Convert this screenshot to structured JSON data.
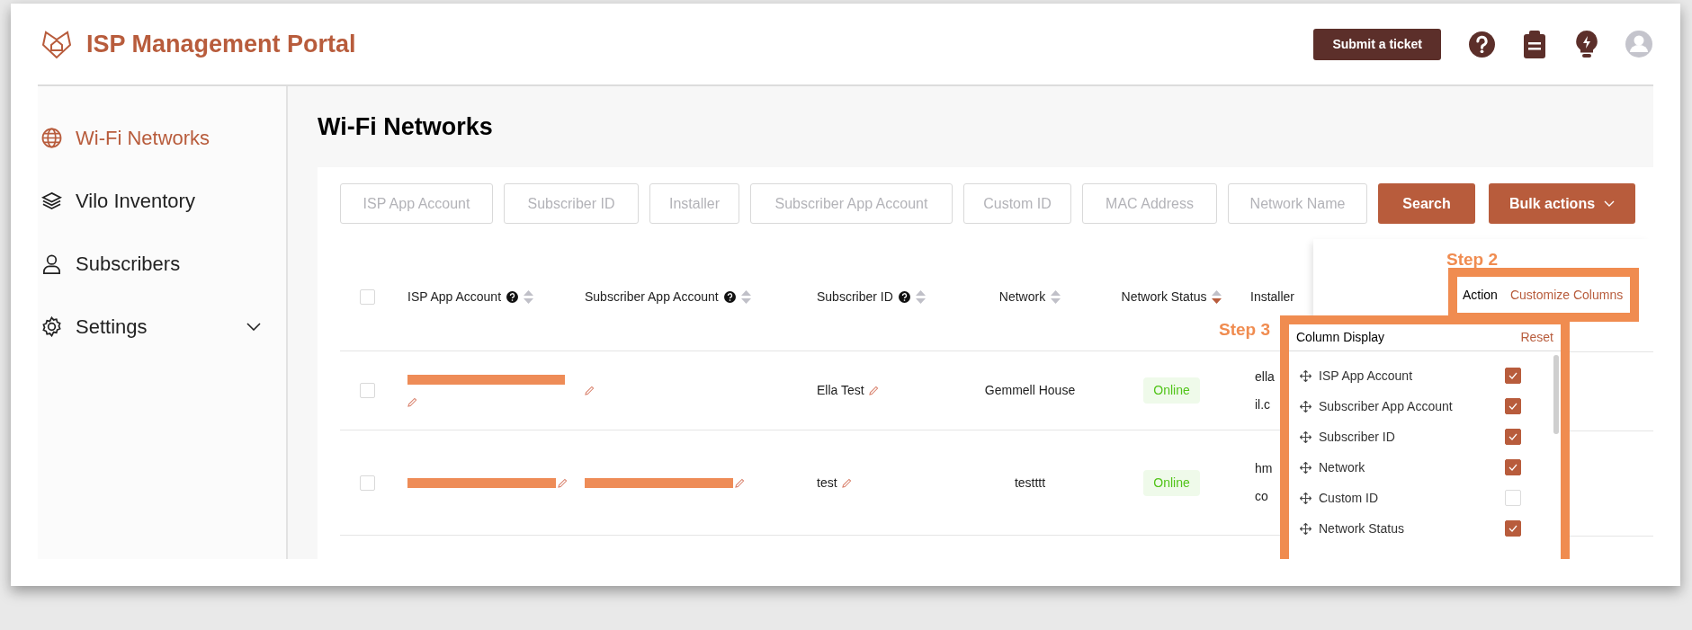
{
  "header": {
    "title": "ISP Management Portal",
    "submit_button": "Submit a ticket"
  },
  "sidebar": {
    "items": [
      {
        "label": "Wi-Fi Networks",
        "selected": true,
        "kind": "link"
      },
      {
        "label": "Vilo Inventory",
        "selected": false,
        "kind": "link"
      },
      {
        "label": "Subscribers",
        "selected": false,
        "kind": "link"
      },
      {
        "label": "Settings",
        "selected": false,
        "kind": "group"
      }
    ]
  },
  "page_title": "Wi-Fi Networks",
  "filters": {
    "fields": [
      {
        "placeholder": "ISP App Account"
      },
      {
        "placeholder": "Subscriber ID"
      },
      {
        "placeholder": "Installer"
      },
      {
        "placeholder": "Subscriber App Account"
      },
      {
        "placeholder": "Custom ID"
      },
      {
        "placeholder": "MAC Address"
      },
      {
        "placeholder": "Network Name"
      }
    ],
    "search_button": "Search",
    "bulk_button": "Bulk actions"
  },
  "table": {
    "select_all_checked": false,
    "columns": [
      {
        "label": "ISP App Account",
        "help": true,
        "sorted": false
      },
      {
        "label": "Subscriber App Account",
        "help": true,
        "sorted": false
      },
      {
        "label": "Subscriber ID",
        "help": true,
        "sorted": false
      },
      {
        "label": "Network",
        "help": false,
        "sorted": false
      },
      {
        "label": "Network Status",
        "help": false,
        "sorted": true
      },
      {
        "label": "Installer",
        "help": false
      }
    ],
    "action_column": "Action",
    "customize_link": "Customize Columns",
    "rows": [
      {
        "checked": false,
        "isp_app_account": {
          "redacted": true
        },
        "subscriber_app_account": {
          "redacted": false
        },
        "subscriber_id": "Ella Test",
        "network": "Gemmell House",
        "status": "Online",
        "installer": [
          "ella",
          "il.c"
        ]
      },
      {
        "checked": false,
        "isp_app_account": {
          "redacted": true
        },
        "subscriber_app_account": {
          "redacted": true
        },
        "subscriber_id": "test",
        "network": "testttt",
        "status": "Online",
        "installer": [
          "hm",
          "co"
        ]
      }
    ]
  },
  "annotations": [
    {
      "label": "Step 2"
    },
    {
      "label": "Step 3"
    }
  ],
  "column_display": {
    "title": "Column Display",
    "reset": "Reset",
    "items": [
      {
        "label": "ISP App Account",
        "checked": true
      },
      {
        "label": "Subscriber App Account",
        "checked": true
      },
      {
        "label": "Subscriber ID",
        "checked": true
      },
      {
        "label": "Network",
        "checked": true
      },
      {
        "label": "Custom ID",
        "checked": false
      },
      {
        "label": "Network Status",
        "checked": true
      }
    ]
  }
}
